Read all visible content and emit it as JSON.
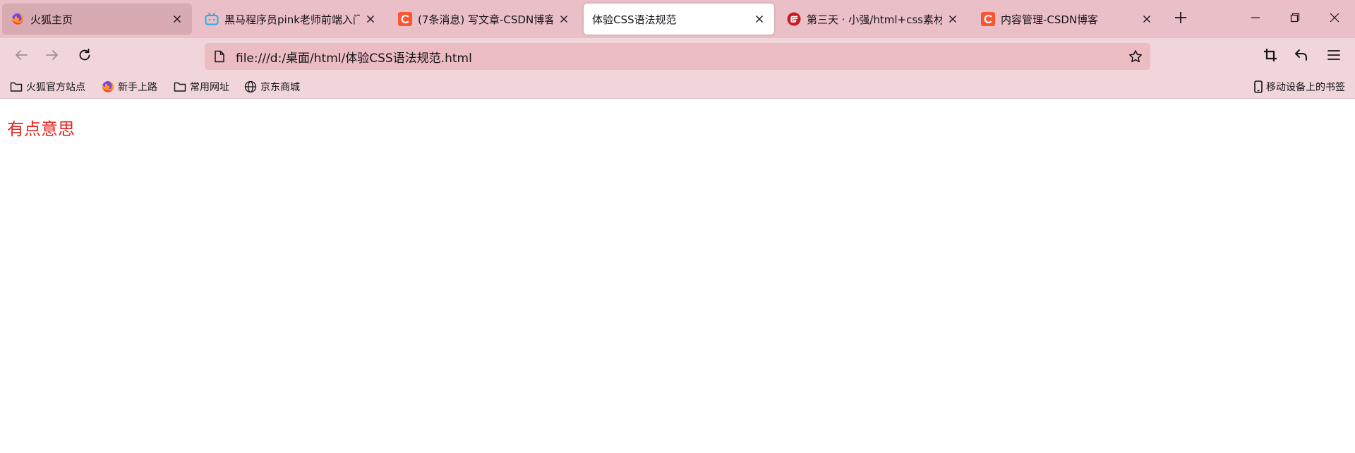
{
  "tabs": [
    {
      "title": "火狐主页",
      "icon": "firefox-icon",
      "active": false
    },
    {
      "title": "黑马程序员pink老师前端入门教",
      "icon": "bilibili-icon",
      "active": false
    },
    {
      "title": "(7条消息) 写文章-CSDN博客",
      "icon": "csdn-icon",
      "active": false
    },
    {
      "title": "体验CSS语法规范",
      "icon": "none",
      "active": true
    },
    {
      "title": "第三天 · 小强/html+css素材 ·",
      "icon": "gitee-icon",
      "active": false
    },
    {
      "title": "内容管理-CSDN博客",
      "icon": "csdn-icon",
      "active": false
    }
  ],
  "toolbar": {
    "url": "file:///d:/桌面/html/体验CSS语法规范.html"
  },
  "bookmarks": {
    "items": [
      {
        "label": "火狐官方站点",
        "icon": "folder-icon"
      },
      {
        "label": "新手上路",
        "icon": "firefox-icon"
      },
      {
        "label": "常用网址",
        "icon": "folder-icon"
      },
      {
        "label": "京东商城",
        "icon": "globe-icon"
      }
    ],
    "mobile_label": "移动设备上的书签"
  },
  "page": {
    "text": "有点意思",
    "text_color": "#e8231e"
  },
  "colors": {
    "tabstrip_bg": "#ebbfc7",
    "toolbar_bg": "#f0d5da",
    "csdn_brand": "#fc5531",
    "bilibili_brand": "#23ade5",
    "gitee_brand": "#c71d23"
  }
}
